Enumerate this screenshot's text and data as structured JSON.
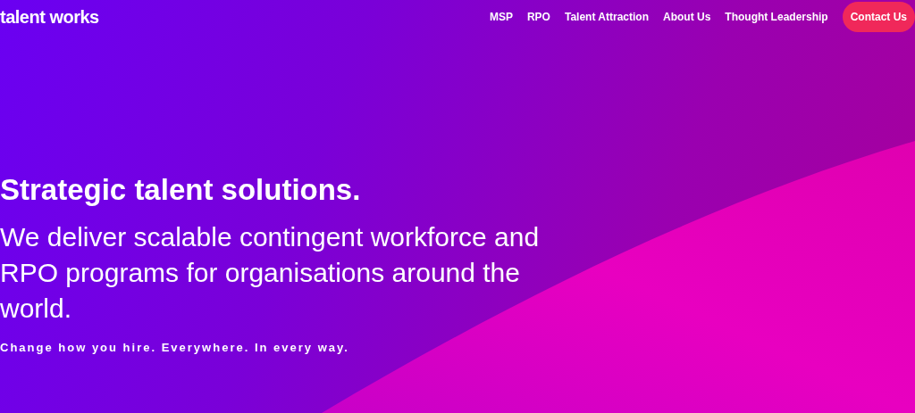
{
  "header": {
    "logo": "talent works",
    "nav": [
      {
        "label": "MSP",
        "kind": "link"
      },
      {
        "label": "RPO",
        "kind": "link"
      },
      {
        "label": "Talent Attraction",
        "kind": "link"
      },
      {
        "label": "About Us",
        "kind": "link"
      },
      {
        "label": "Thought Leadership",
        "kind": "link"
      },
      {
        "label": "Contact Us",
        "kind": "cta"
      }
    ]
  },
  "hero": {
    "headline": "Strategic talent solutions.",
    "subheadline": "We deliver scalable contingent workforce and RPO programs for organisations around the world.",
    "tagline": "Change how you hire. Everywhere. In every way."
  }
}
